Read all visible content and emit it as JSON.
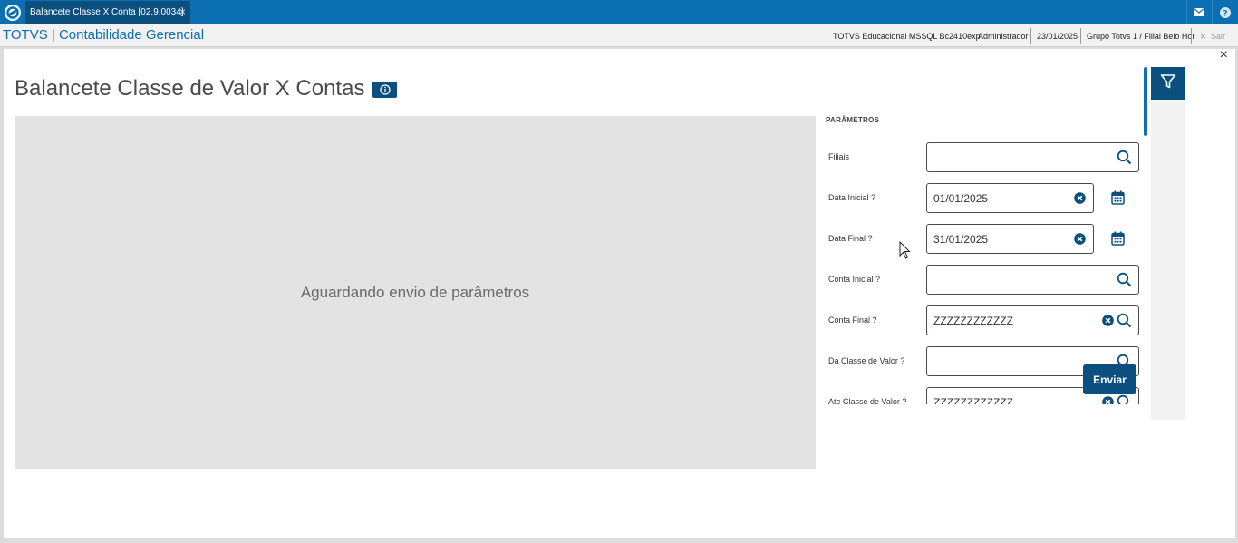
{
  "topbar": {
    "tab_label": "Balancete Classe X Conta [02.9.0034]",
    "tab_close": "×"
  },
  "header": {
    "app_title": "TOTVS | Contabilidade Gerencial",
    "environment": "TOTVS Educacional MSSQL Bc2410exp",
    "user": "Administrador",
    "date": "23/01/2025",
    "branch": "Grupo Totvs 1 / Filial Belo Hor",
    "logout_label": "Sair"
  },
  "page": {
    "title": "Balancete Classe de Valor X Contas",
    "close_glyph": "×",
    "preview_message": "Aguardando envio de parâmetros"
  },
  "params": {
    "section_title": "PARÂMETROS",
    "fields": [
      {
        "label": "Filiais",
        "value": ""
      },
      {
        "label": "Data Inicial ?",
        "value": "01/01/2025"
      },
      {
        "label": "Data Final ?",
        "value": "31/01/2025"
      },
      {
        "label": "Conta Inicial ?",
        "value": ""
      },
      {
        "label": "Conta Final ?",
        "value": "ZZZZZZZZZZZZ"
      },
      {
        "label": "Da Classe de Valor ?",
        "value": ""
      },
      {
        "label": "Ate Classe de Valor ?",
        "value": "ZZZZZZZZZZZZ"
      }
    ],
    "send_label": "Enviar"
  },
  "colors": {
    "brand_blue": "#0c6fb2",
    "dark_blue": "#0a4f7e",
    "preview_bg": "#e3e3e3"
  },
  "icons": [
    "totvs-logo-icon",
    "mail-icon",
    "help-icon",
    "info-icon",
    "search-icon",
    "clear-icon",
    "calendar-icon",
    "filter-icon",
    "cursor-icon"
  ]
}
